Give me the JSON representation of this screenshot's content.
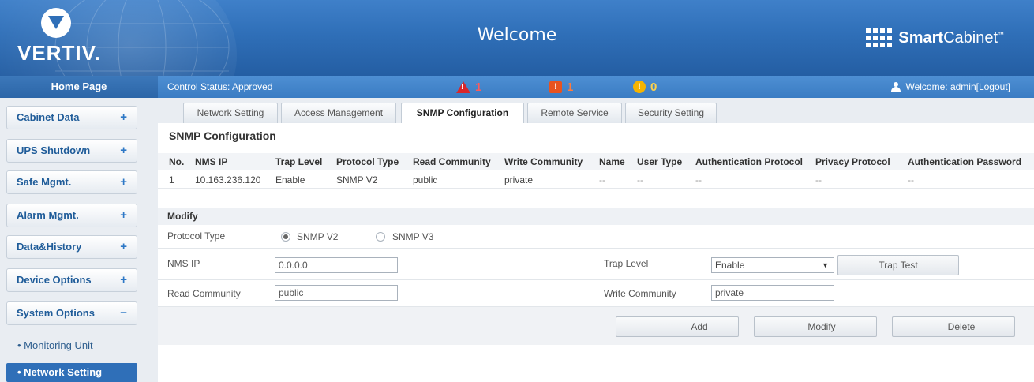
{
  "header": {
    "logo_text": "VERTIV.",
    "title": "Welcome",
    "brand_bold": "Smart",
    "brand_rest": "Cabinet",
    "brand_tm": "™"
  },
  "statusbar": {
    "home": "Home Page",
    "control_status": "Control Status:  Approved",
    "critical_count": "1",
    "major_count": "1",
    "minor_count": "0",
    "welcome": "Welcome: admin[Logout]"
  },
  "sidebar": {
    "items": [
      {
        "label": "Cabinet Data",
        "sign": "+"
      },
      {
        "label": "UPS Shutdown",
        "sign": "+"
      },
      {
        "label": "Safe Mgmt.",
        "sign": "+"
      },
      {
        "label": "Alarm Mgmt.",
        "sign": "+"
      },
      {
        "label": "Data&History",
        "sign": "+"
      },
      {
        "label": "Device Options",
        "sign": "+"
      },
      {
        "label": "System Options",
        "sign": "−"
      }
    ],
    "subitems": [
      {
        "label": "• Monitoring Unit"
      },
      {
        "label": "• Network Setting"
      }
    ]
  },
  "tabs": [
    {
      "label": "Network Setting"
    },
    {
      "label": "Access Management"
    },
    {
      "label": "SNMP Configuration"
    },
    {
      "label": "Remote Service"
    },
    {
      "label": "Security Setting"
    }
  ],
  "main": {
    "section_title": "SNMP Configuration",
    "columns": [
      "No.",
      "NMS IP",
      "Trap Level",
      "Protocol Type",
      "Read Community",
      "Write Community",
      "Name",
      "User Type",
      "Authentication Protocol",
      "Privacy Protocol",
      "Authentication Password"
    ],
    "rows": [
      [
        "1",
        "10.163.236.120",
        "Enable",
        "SNMP V2",
        "public",
        "private",
        "--",
        "--",
        "--",
        "--",
        "--"
      ]
    ],
    "modify_title": "Modify",
    "form": {
      "protocol_type_label": "Protocol Type",
      "snmp_v2_label": "SNMP V2",
      "snmp_v3_label": "SNMP V3",
      "selected_protocol": "SNMP V2",
      "nms_ip_label": "NMS IP",
      "nms_ip_value": "0.0.0.0",
      "trap_level_label": "Trap Level",
      "trap_level_value": "Enable",
      "trap_test_label": "Trap Test",
      "read_community_label": "Read Community",
      "read_community_value": "public",
      "write_community_label": "Write Community",
      "write_community_value": "private"
    },
    "buttons": {
      "add": "Add",
      "modify": "Modify",
      "delete": "Delete"
    }
  },
  "colors": {
    "header_blue": "#2f6fb8",
    "critical": "#d9262a",
    "major": "#e8531f",
    "minor": "#f5b400"
  }
}
